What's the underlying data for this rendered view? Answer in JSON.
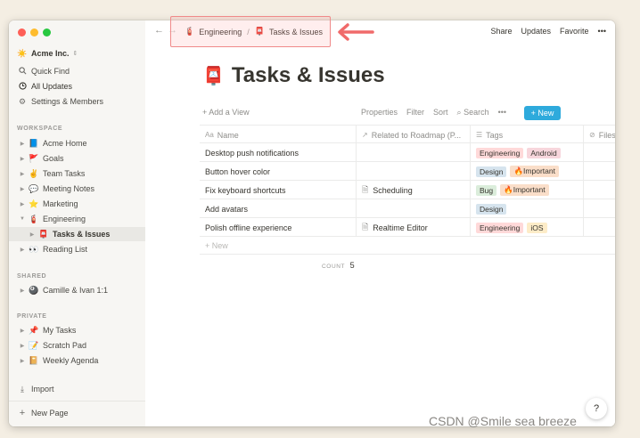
{
  "sidebar": {
    "workspace_name": "Acme Inc.",
    "workspace_icon": "☀️",
    "top_items": [
      {
        "label": "Quick Find",
        "icon": "search-icon"
      },
      {
        "label": "All Updates",
        "icon": "clock-icon"
      },
      {
        "label": "Settings & Members",
        "icon": "gear-icon"
      }
    ],
    "sections": {
      "workspace": "WORKSPACE",
      "shared": "SHARED",
      "private": "PRIVATE"
    },
    "workspace_items": [
      {
        "label": "Acme Home",
        "emoji": "📘"
      },
      {
        "label": "Goals",
        "emoji": "🚩"
      },
      {
        "label": "Team Tasks",
        "emoji": "✌️"
      },
      {
        "label": "Meeting Notes",
        "emoji": "💬"
      },
      {
        "label": "Marketing",
        "emoji": "⭐"
      },
      {
        "label": "Engineering",
        "emoji": "🧯"
      },
      {
        "label": "Tasks & Issues",
        "emoji": "📮"
      },
      {
        "label": "Reading List",
        "emoji": "👀"
      }
    ],
    "shared_items": [
      {
        "label": "Camille & Ivan 1:1",
        "emoji": "🎱"
      }
    ],
    "private_items": [
      {
        "label": "My Tasks",
        "emoji": "📌"
      },
      {
        "label": "Scratch Pad",
        "emoji": "📝"
      },
      {
        "label": "Weekly Agenda",
        "emoji": "📔"
      }
    ],
    "import_label": "Import",
    "new_page_label": "New Page"
  },
  "topbar": {
    "breadcrumb": [
      {
        "label": "Engineering",
        "emoji": "🧯"
      },
      {
        "label": "Tasks & Issues",
        "emoji": "📮"
      }
    ],
    "separator": "/",
    "actions": [
      "Share",
      "Updates",
      "Favorite",
      "•••"
    ]
  },
  "page": {
    "title": "Tasks & Issues",
    "title_emoji": "📮"
  },
  "toolbar": {
    "add_view": "+ Add a View",
    "tools": [
      "Properties",
      "Filter",
      "Sort",
      "Search",
      "•••"
    ],
    "new_button": "+ New"
  },
  "table": {
    "columns": [
      "Name",
      "Related to Roadmap (P...",
      "Tags",
      "Files"
    ],
    "rows": [
      {
        "name": "Desktop push notifications",
        "related": "",
        "tags": [
          "Engineering",
          "Android"
        ]
      },
      {
        "name": "Button hover color",
        "related": "",
        "tags": [
          "Design",
          "🔥Important"
        ]
      },
      {
        "name": "Fix keyboard shortcuts",
        "related": "Scheduling",
        "tags": [
          "Bug",
          "🔥Important"
        ]
      },
      {
        "name": "Add avatars",
        "related": "",
        "tags": [
          "Design"
        ]
      },
      {
        "name": "Polish offline experience",
        "related": "Realtime Editor",
        "tags": [
          "Engineering",
          "iOS"
        ]
      }
    ],
    "new_row_label": "+ New",
    "count_label": "COUNT",
    "count_value": "5"
  },
  "help_label": "?",
  "watermark": "CSDN @Smile sea breeze"
}
